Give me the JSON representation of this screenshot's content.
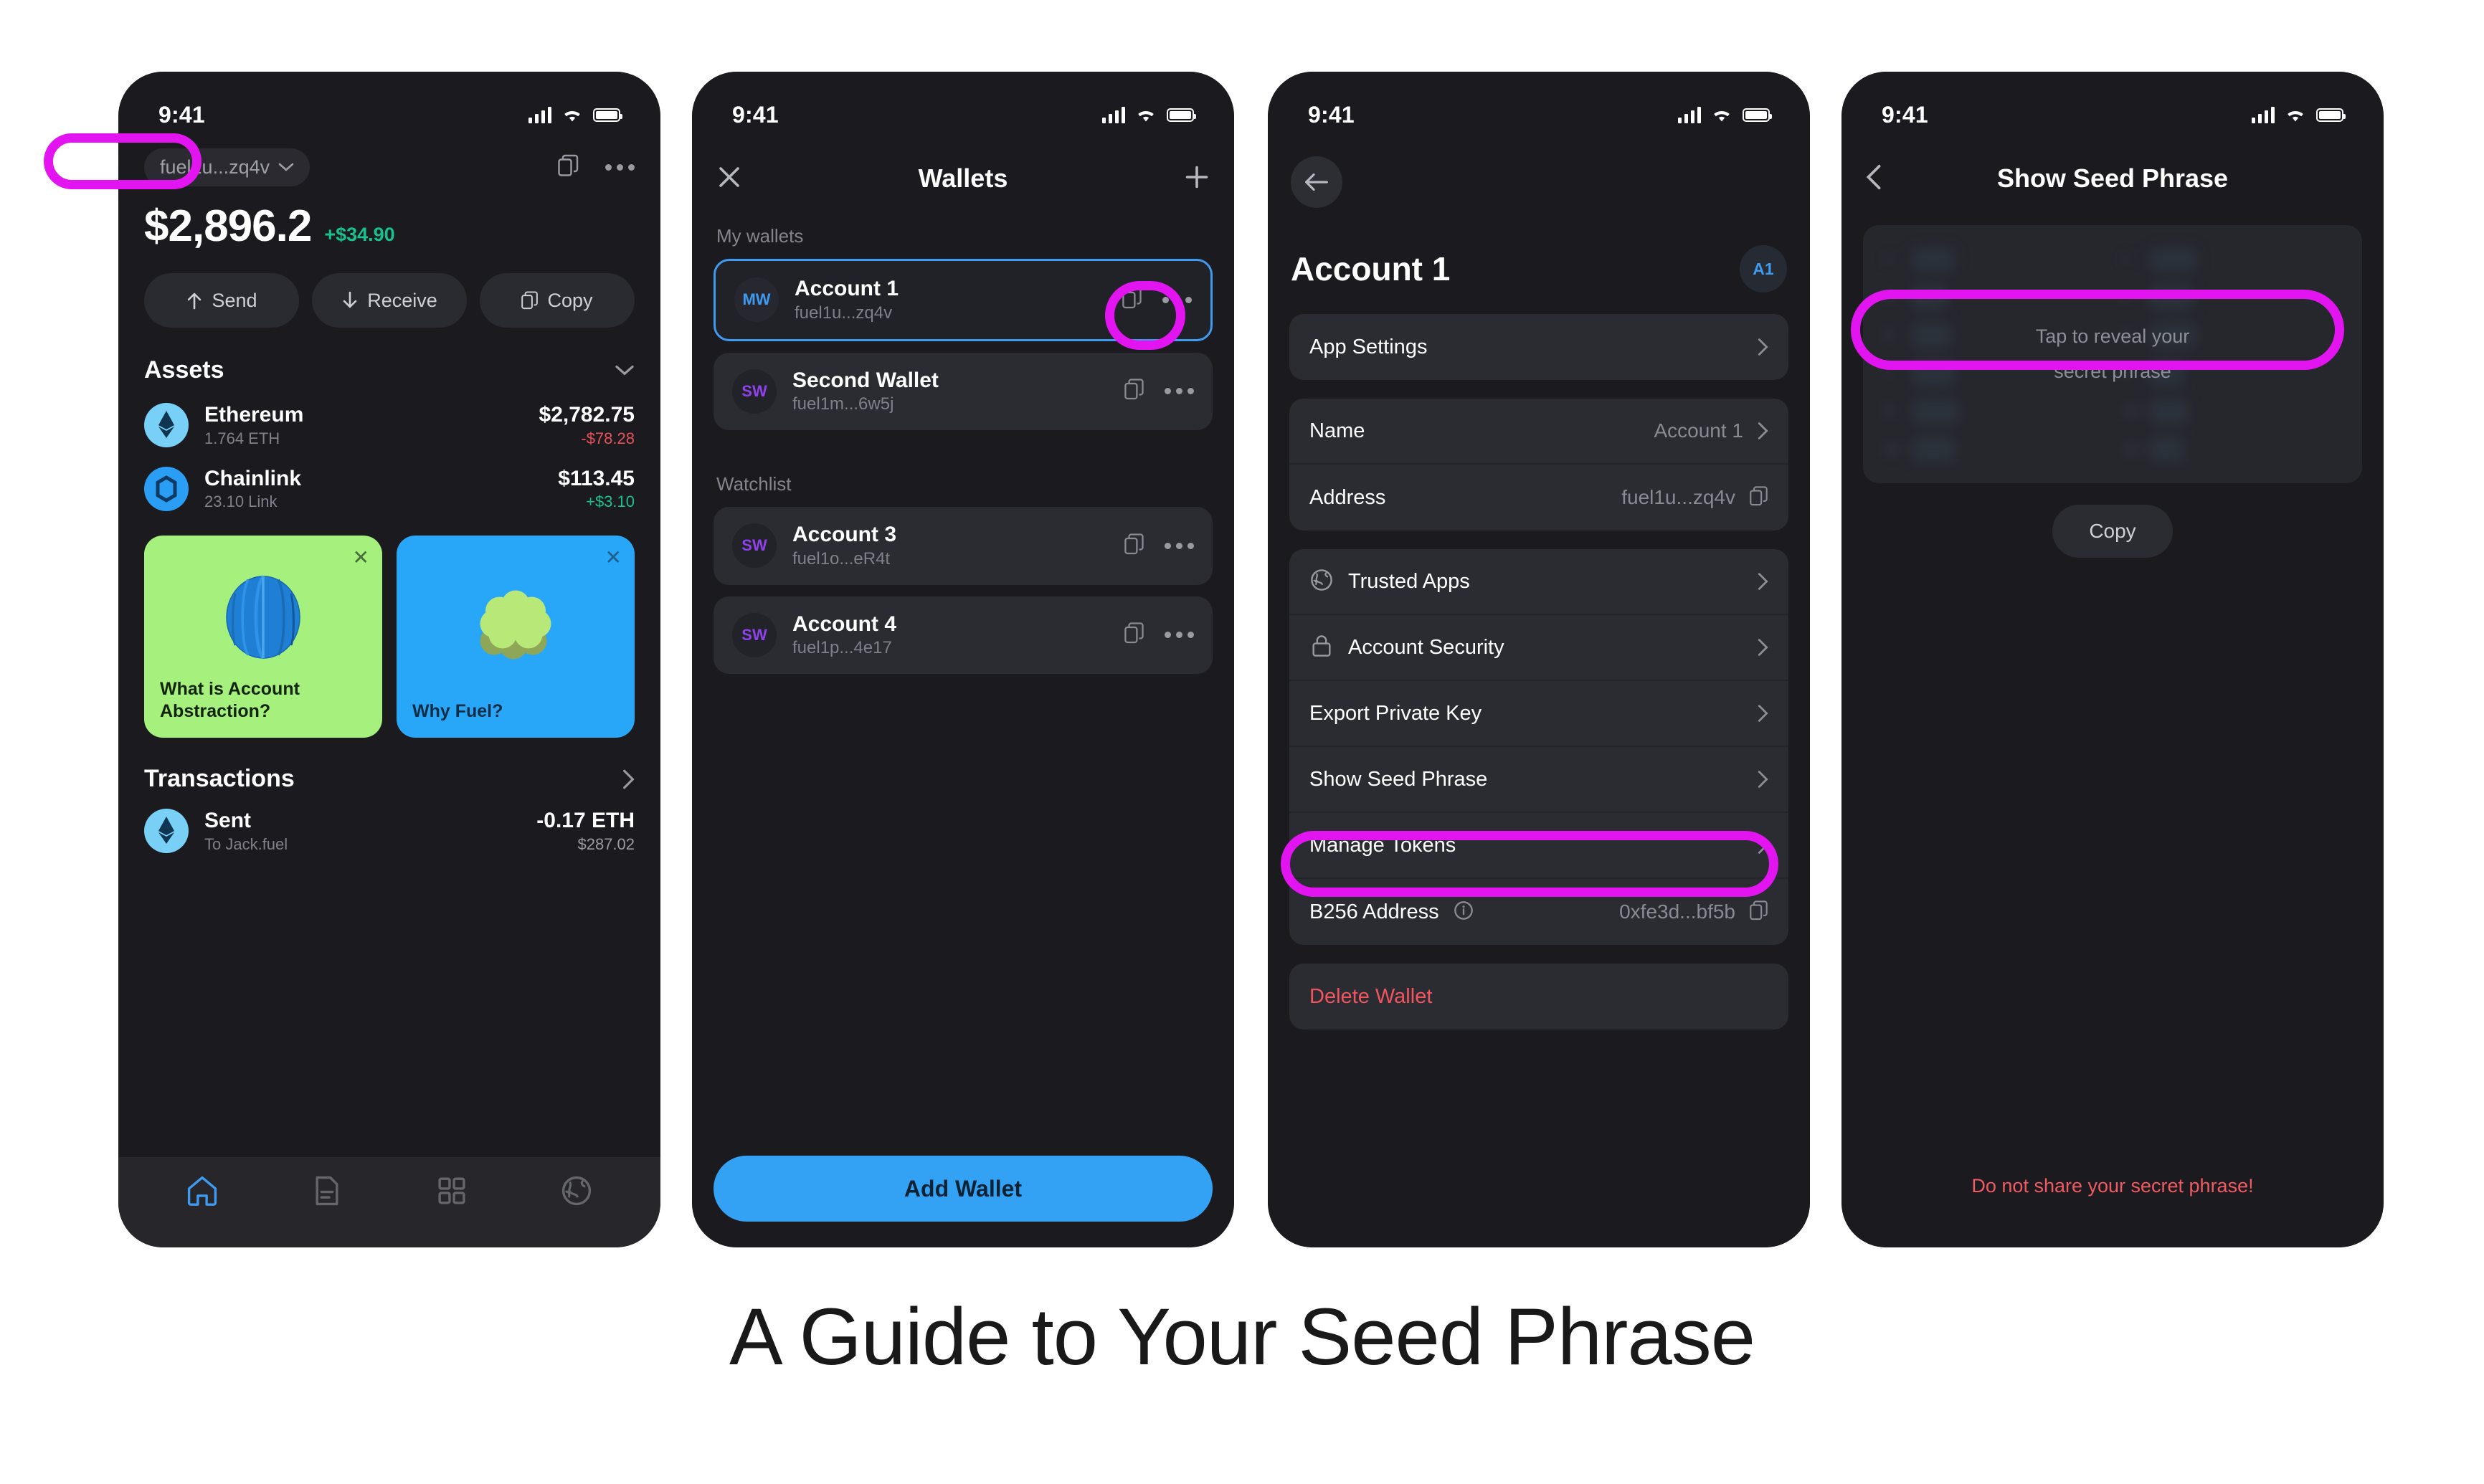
{
  "caption": "A Guide to Your Seed Phrase",
  "status": {
    "time": "9:41"
  },
  "colors": {
    "accent_blue": "#33a2f5",
    "annotation_magenta": "#e215f0",
    "positive_green": "#18c08f",
    "negative_red": "#e8505b",
    "danger_red": "#f0555f",
    "promo_green": "#a6f07e",
    "promo_blue": "#28a6f7"
  },
  "phone1": {
    "address_pill": "fuel1u...zq4v",
    "balance": "$2,896.2",
    "balance_change": "+$34.90",
    "actions": [
      {
        "label": "Send",
        "icon": "arrow-up-icon"
      },
      {
        "label": "Receive",
        "icon": "arrow-down-icon"
      },
      {
        "label": "Copy",
        "icon": "copy-icon"
      }
    ],
    "assets_title": "Assets",
    "assets": [
      {
        "name": "Ethereum",
        "amount": "1.764 ETH",
        "value": "$2,782.75",
        "change": "-$78.28",
        "change_dir": "negative"
      },
      {
        "name": "Chainlink",
        "amount": "23.10 Link",
        "value": "$113.45",
        "change": "+$3.10",
        "change_dir": "positive"
      }
    ],
    "promos": [
      {
        "title": "What is Account Abstraction?",
        "theme": "green"
      },
      {
        "title": "Why Fuel?",
        "theme": "blue"
      }
    ],
    "transactions_title": "Transactions",
    "transactions": [
      {
        "type": "Sent",
        "counterparty": "To Jack.fuel",
        "amount": "-0.17 ETH",
        "fiat": "$287.02"
      }
    ],
    "nav": [
      {
        "name": "home-icon",
        "active": true
      },
      {
        "name": "document-icon",
        "active": false
      },
      {
        "name": "grid-icon",
        "active": false
      },
      {
        "name": "globe-icon",
        "active": false
      }
    ]
  },
  "phone2": {
    "title": "Wallets",
    "close_icon": "close-icon",
    "add_icon": "plus-icon",
    "my_wallets_label": "My wallets",
    "watchlist_label": "Watchlist",
    "my_wallets": [
      {
        "initials": "MW",
        "name": "Account 1",
        "address": "fuel1u...zq4v",
        "selected": true
      },
      {
        "initials": "SW",
        "name": "Second Wallet",
        "address": "fuel1m...6w5j",
        "selected": false
      }
    ],
    "watchlist": [
      {
        "initials": "SW",
        "name": "Account 3",
        "address": "fuel1o...eR4t",
        "selected": false
      },
      {
        "initials": "SW",
        "name": "Account 4",
        "address": "fuel1p...4e17",
        "selected": false
      }
    ],
    "add_wallet_label": "Add Wallet"
  },
  "phone3": {
    "back_icon": "arrow-left-icon",
    "title": "Account 1",
    "badge": "A1",
    "groups": [
      {
        "rows": [
          {
            "label": "App Settings",
            "value": "",
            "icon": "",
            "chevron": true
          }
        ]
      },
      {
        "rows": [
          {
            "label": "Name",
            "value": "Account 1",
            "icon": "",
            "chevron": true
          },
          {
            "label": "Address",
            "value": "fuel1u...zq4v",
            "icon": "",
            "chevron": false,
            "copy": true
          }
        ]
      },
      {
        "rows": [
          {
            "label": "Trusted Apps",
            "value": "",
            "icon": "globe-icon",
            "chevron": true
          },
          {
            "label": "Account Security",
            "value": "",
            "icon": "lock-icon",
            "chevron": true
          },
          {
            "label": "Export Private Key",
            "value": "",
            "icon": "",
            "chevron": true
          },
          {
            "label": "Show Seed Phrase",
            "value": "",
            "icon": "",
            "chevron": true
          },
          {
            "label": "Manage Tokens",
            "value": "",
            "icon": "",
            "chevron": true
          },
          {
            "label": "B256 Address",
            "value": "0xfe3d...bf5b",
            "icon": "",
            "chevron": false,
            "info": true,
            "copy": true
          }
        ]
      },
      {
        "rows": [
          {
            "label": "Delete Wallet",
            "value": "",
            "icon": "",
            "chevron": false,
            "danger": true
          }
        ]
      }
    ]
  },
  "phone4": {
    "back_icon": "chevron-left-icon",
    "title": "Show Seed Phrase",
    "reveal_line1": "Tap to reveal your",
    "reveal_line2": "secret phrase",
    "copy_label": "Copy",
    "warning": "Do not share your secret phrase!",
    "hidden_words": [
      "1",
      "2",
      "3",
      "4",
      "5",
      "6",
      "7",
      "8",
      "9",
      "10",
      "11",
      "12"
    ]
  },
  "annotations": [
    {
      "target": "address-pill",
      "phone": 1
    },
    {
      "target": "wallet-row-more-button",
      "phone": 2
    },
    {
      "target": "show-seed-phrase-row",
      "phone": 3
    },
    {
      "target": "tap-to-reveal-area",
      "phone": 4
    }
  ]
}
